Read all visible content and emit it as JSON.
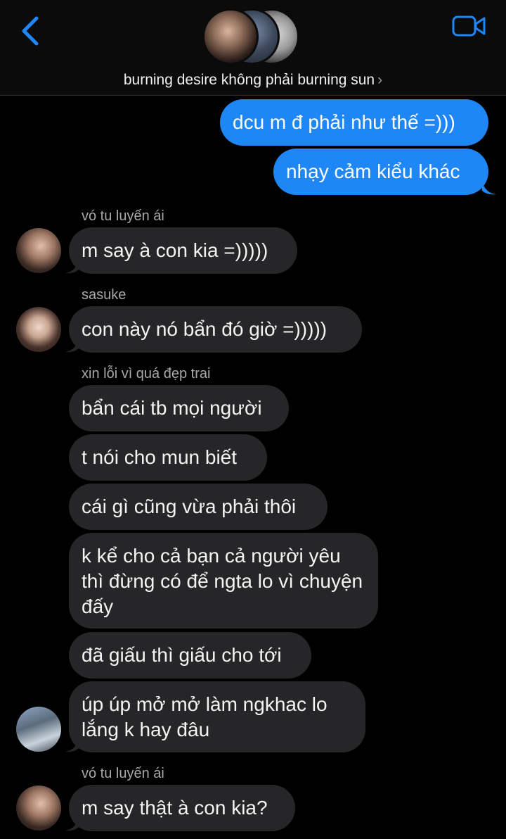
{
  "header": {
    "group_name": "burning desire không phải burning sun",
    "chevron": "›",
    "back_icon": "chevron-left-icon",
    "video_icon": "video-camera-icon",
    "accent": "#1f86f5"
  },
  "messages": [
    {
      "direction": "out",
      "text": "dcu m đ phải như thế =)))"
    },
    {
      "direction": "out",
      "text": "nhạy cảm kiểu khác"
    },
    {
      "direction": "in",
      "sender": "vó tu luyến ái",
      "text": "m say à con kia =)))))"
    },
    {
      "direction": "in",
      "sender": "sasuke",
      "text": "con này nó bẩn đó giờ =)))))"
    },
    {
      "direction": "in",
      "sender": "xin lỗi vì quá đẹp trai",
      "text": "bẩn cái tb mọi người"
    },
    {
      "direction": "in",
      "text": "t nói cho mun biết"
    },
    {
      "direction": "in",
      "text": "cái gì cũng vừa phải thôi"
    },
    {
      "direction": "in",
      "text": "k kể cho cả bạn cả người yêu thì đừng có để ngta lo vì chuyện đấy"
    },
    {
      "direction": "in",
      "text": "đã giấu thì giấu cho tới"
    },
    {
      "direction": "in",
      "text": "úp úp mở mở làm ngkhac lo lắng k hay đâu"
    },
    {
      "direction": "in",
      "sender": "vó tu luyến ái",
      "text": "m say thật à con kia?"
    }
  ],
  "colors": {
    "outgoing_bubble": "#1f86f5",
    "incoming_bubble": "#262628",
    "background": "#000000"
  }
}
